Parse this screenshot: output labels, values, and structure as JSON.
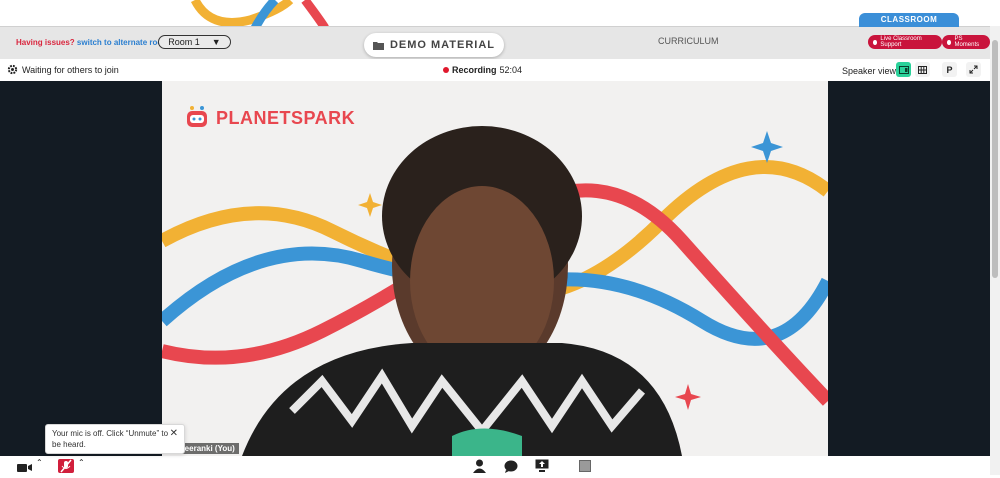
{
  "header": {
    "issues_text": "Having issues?",
    "switch_link": "switch to alternate room",
    "room_label": "Room 1",
    "demo_material_label": "DEMO MATERIAL",
    "curriculum_label": "CURRICULUM",
    "classroom_tab": "CLASSROOM",
    "live_support_button": "Live Classroom Support",
    "ps_moments_button": "PS Moments"
  },
  "toolbar": {
    "status_text": "Waiting for others to join",
    "recording_label": "Recording",
    "recording_time": "52:04",
    "view_label": "Speaker view",
    "p_button": "P"
  },
  "video": {
    "logo_text": "PLANETSPARK",
    "participant_name": "ahi Veeranki (You)"
  },
  "tooltip": {
    "message": "Your mic is off. Click “Unmute” to be heard.",
    "close": "✕"
  },
  "colors": {
    "accent_green": "#2bd19a",
    "brand_red": "#c9143c",
    "classroom_blue": "#3b8fd8",
    "recording_red": "#e0182d"
  }
}
